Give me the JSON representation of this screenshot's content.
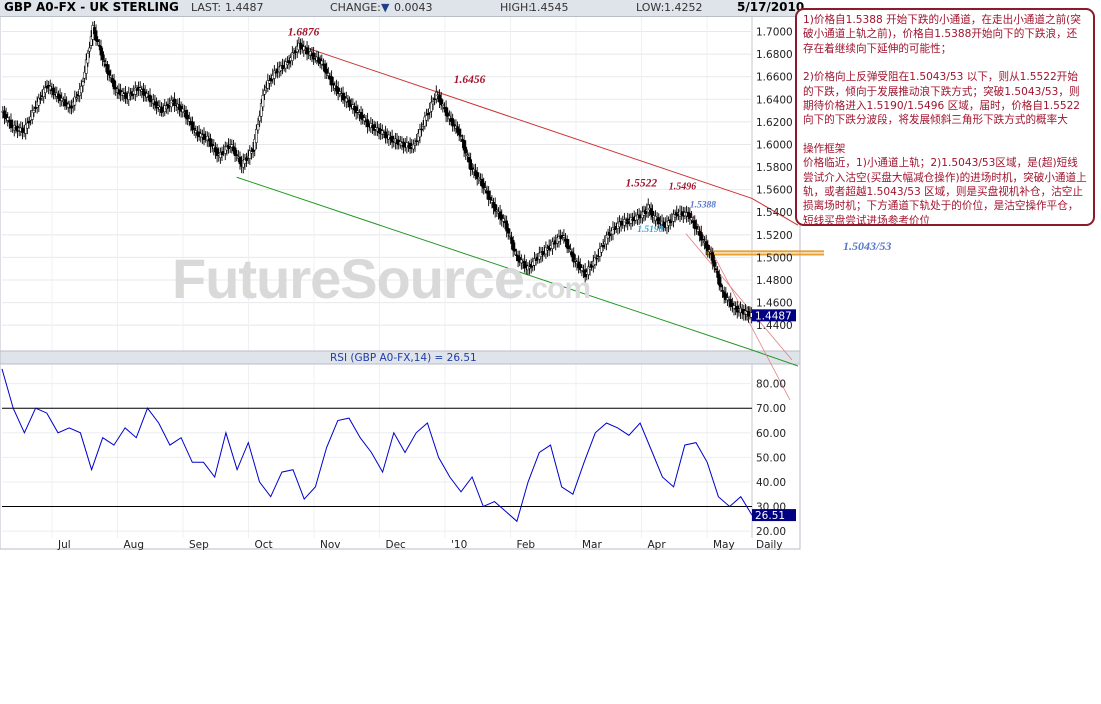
{
  "header": {
    "title": "GBP A0-FX - UK STERLING",
    "last_label": "LAST:",
    "last_value": "1.4487",
    "change_label": "CHANGE:",
    "change_arrow": "▼",
    "change_value": "0.0043",
    "high_label": "HIGH:",
    "high_value": "1.4545",
    "low_label": "LOW:",
    "low_value": "1.4252",
    "date": "5/17/2010"
  },
  "watermark": {
    "main": "FutureSource",
    "suffix": ".com"
  },
  "notes": {
    "p1": "1)价格自1.5388 开始下跌的小通道，在走出小通道之前(突破小通道上轨之前)，价格自1.5388开始向下的下跌浪，还存在着继续向下延伸的可能性；",
    "p2": "2)价格向上反弹受阻在1.5043/53 以下，则从1.5522开始的下跌，倾向于发展推动浪下跌方式；突破1.5043/53，则期待价格进入1.5190/1.5496 区域，届时，价格自1.5522向下的下跌分波段，将发展倾斜三角形下跌方式的概率大",
    "p3": "操作框架",
    "p4": "价格临近，1)小通道上轨；2)1.5043/53区域，是(超)短线尝试介入沽空(买盘大幅减仓操作)的进场时机，突破小通道上轨，或者超越1.5043/53 区域，则是买盘视机补仓，沽空止损离场时机；下方通道下轨处于的价位，是沽空操作平仓，短线买盘尝试进场参考价位"
  },
  "colors": {
    "price": "#000000",
    "rsi": "#0000cc",
    "upper_channel": "#cc3333",
    "lower_channel": "#229922",
    "annotation_red": "#a0142e",
    "annotation_blue": "#5577cc",
    "level_band": "#e8a030",
    "last_box": "#000080"
  },
  "chart_data": [
    {
      "type": "candlestick",
      "title": "GBP A0-FX - UK STERLING",
      "frequency": "Daily",
      "x_ticks": [
        "Jul",
        "Aug",
        "Sep",
        "Oct",
        "Nov",
        "Dec",
        "'10",
        "Feb",
        "Mar",
        "Apr",
        "May",
        "Daily"
      ],
      "y_ticks": [
        "1.7000",
        "1.6800",
        "1.6600",
        "1.6400",
        "1.6200",
        "1.6000",
        "1.5800",
        "1.5600",
        "1.5400",
        "1.5200",
        "1.5000",
        "1.4800",
        "1.4600",
        "1.4400"
      ],
      "y_tick_values": [
        1.7,
        1.68,
        1.66,
        1.64,
        1.62,
        1.6,
        1.58,
        1.56,
        1.54,
        1.52,
        1.5,
        1.48,
        1.46,
        1.44
      ],
      "ylim": [
        1.418,
        1.712
      ],
      "x": [
        0,
        4,
        8,
        12,
        16,
        20,
        24,
        28,
        32,
        36,
        40,
        44,
        48,
        52,
        56,
        60,
        64,
        68,
        72,
        76,
        80,
        84,
        88,
        92,
        96,
        100,
        104,
        108,
        112,
        116,
        120,
        124,
        128,
        132,
        136,
        140,
        144,
        148,
        152,
        156,
        160,
        164,
        168,
        172,
        176,
        180,
        184,
        188,
        192,
        196,
        200,
        204,
        208,
        212,
        216,
        220,
        224,
        226,
        228,
        232,
        236,
        240,
        244,
        248,
        252,
        256,
        260,
        262
      ],
      "close": [
        1.63,
        1.615,
        1.612,
        1.634,
        1.652,
        1.642,
        1.632,
        1.65,
        1.703,
        1.672,
        1.648,
        1.642,
        1.65,
        1.64,
        1.63,
        1.638,
        1.628,
        1.61,
        1.605,
        1.59,
        1.6,
        1.582,
        1.596,
        1.65,
        1.665,
        1.672,
        1.688,
        1.68,
        1.672,
        1.652,
        1.64,
        1.63,
        1.618,
        1.612,
        1.605,
        1.6,
        1.598,
        1.622,
        1.645,
        1.625,
        1.61,
        1.58,
        1.565,
        1.545,
        1.53,
        1.5,
        1.49,
        1.502,
        1.51,
        1.52,
        1.498,
        1.485,
        1.5,
        1.52,
        1.53,
        1.533,
        1.538,
        1.544,
        1.535,
        1.528,
        1.539,
        1.538,
        1.52,
        1.502,
        1.468,
        1.455,
        1.451,
        1.4487
      ],
      "annotations": [
        {
          "text": "1.6876",
          "x": 104,
          "y": 1.6876
        },
        {
          "text": "1.6456",
          "x": 162,
          "y": 1.6456
        },
        {
          "text": "1.5522",
          "x": 222,
          "y": 1.5522
        },
        {
          "text": "1.5496",
          "x": 235,
          "y": 1.5496
        },
        {
          "text": "1.5388",
          "x": 241,
          "y": 1.5388
        },
        {
          "text": "1.5190",
          "x": 224,
          "y": 1.519
        },
        {
          "text": "1.5043/53",
          "x": 262,
          "y": 1.5048
        }
      ],
      "upper_channel": [
        [
          104,
          1.6876
        ],
        [
          262,
          1.5522
        ]
      ],
      "lower_channel": [
        [
          82,
          1.571
        ],
        [
          262,
          1.418
        ]
      ],
      "small_channel": [
        [
          241,
          1.5388
        ],
        [
          262,
          1.418
        ]
      ],
      "level_band": [
        1.5043,
        1.5053
      ],
      "last_price": "1.4487"
    },
    {
      "type": "line",
      "title": "RSI (GBP A0-FX,14) = 26.51",
      "series": [
        {
          "name": "RSI (GBP A0-FX,14) = 26.51",
          "values": [
            86,
            70,
            60,
            70,
            68,
            60,
            62,
            60,
            45,
            58,
            55,
            62,
            58,
            70,
            64,
            55,
            58,
            48,
            48,
            42,
            60,
            45,
            56,
            40,
            34,
            44,
            45,
            33,
            38,
            54,
            65,
            66,
            58,
            52,
            44,
            60,
            52,
            60,
            64,
            50,
            42,
            36,
            42,
            30,
            32,
            28,
            24,
            40,
            52,
            55,
            38,
            35,
            48,
            60,
            64,
            62,
            59,
            64,
            53,
            42,
            38,
            55,
            56,
            48,
            34,
            30,
            34,
            26.51
          ]
        }
      ],
      "y_ticks": [
        "80.00",
        "70.00",
        "60.00",
        "50.00",
        "40.00",
        "30.00",
        "20.00"
      ],
      "y_tick_values": [
        80,
        70,
        60,
        50,
        40,
        30,
        20
      ],
      "ylim": [
        18,
        88
      ],
      "levels": [
        70,
        30
      ],
      "last_value": "26.51"
    }
  ]
}
